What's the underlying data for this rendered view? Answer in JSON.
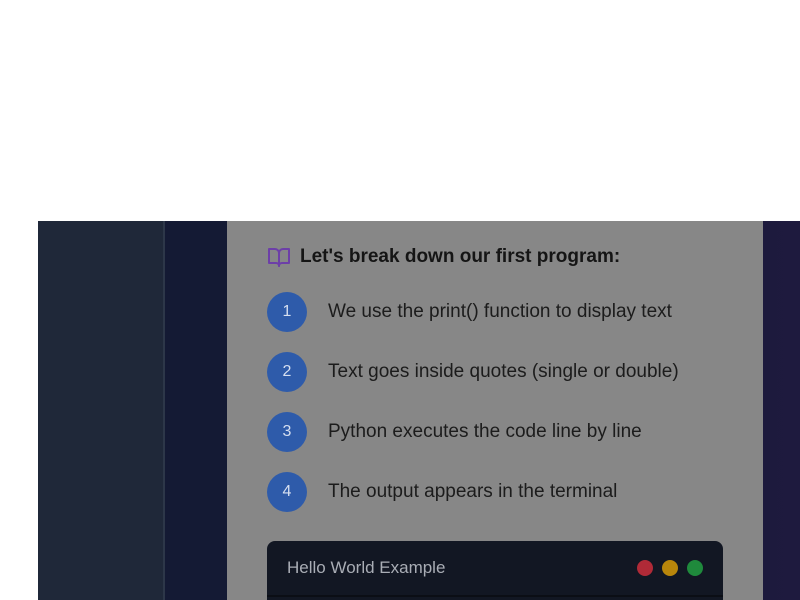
{
  "lesson": {
    "heading": "Let's break down our first program:",
    "heading_icon": "book-icon",
    "steps": [
      {
        "number": "1",
        "text": "We use the print() function to display text"
      },
      {
        "number": "2",
        "text": "Text goes inside quotes (single or double)"
      },
      {
        "number": "3",
        "text": "Python executes the code line by line"
      },
      {
        "number": "4",
        "text": "The output appears in the terminal"
      }
    ]
  },
  "code_panel": {
    "title": "Hello World Example",
    "window_dots": [
      "#b02a37",
      "#b8860b",
      "#1f8a3c"
    ]
  },
  "colors": {
    "accent": "#2e5baa",
    "icon": "#6d3fa8",
    "card_background": "#878787",
    "sidebar_background": "#1f2839"
  }
}
